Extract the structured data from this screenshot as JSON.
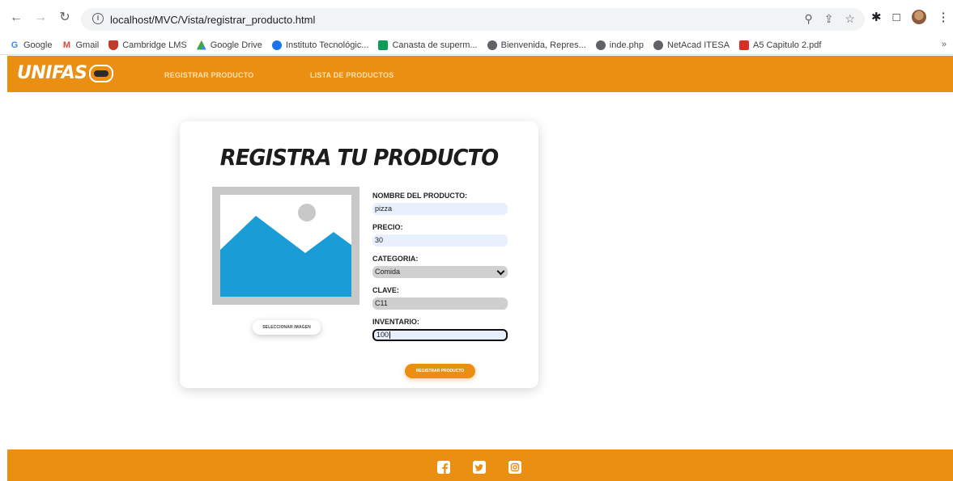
{
  "browser": {
    "url": "localhost/MVC/Vista/registrar_producto.html",
    "bookmarks": [
      {
        "label": "Google",
        "icon": "google-icon",
        "color": "#4285f4"
      },
      {
        "label": "Gmail",
        "icon": "gmail-icon",
        "color": "#ea4335"
      },
      {
        "label": "Cambridge LMS",
        "icon": "cambridge-icon",
        "color": "#c0392b"
      },
      {
        "label": "Google Drive",
        "icon": "drive-icon",
        "color": "#34a853"
      },
      {
        "label": "Instituto Tecnológic...",
        "icon": "institute-icon",
        "color": "#1a73e8"
      },
      {
        "label": "Canasta de superm...",
        "icon": "sheets-icon",
        "color": "#0f9d58"
      },
      {
        "label": "Bienvenida, Repres...",
        "icon": "globe-icon",
        "color": "#5f6368"
      },
      {
        "label": "inde.php",
        "icon": "globe-icon",
        "color": "#5f6368"
      },
      {
        "label": "NetAcad ITESA",
        "icon": "globe-icon",
        "color": "#5f6368"
      },
      {
        "label": "A5 Capitulo 2.pdf",
        "icon": "pdf-icon",
        "color": "#d93025"
      }
    ],
    "more": "»"
  },
  "header": {
    "logo": "UNIFAS",
    "nav": [
      "REGISTRAR PRODUCTO",
      "LISTA DE PRODUCTOS"
    ]
  },
  "card": {
    "title": "REGISTRA TU PRODUCTO",
    "select_image_label": "SELECCIONAR IMAGEN",
    "submit_label": "REGISTRAR PRODUCTO",
    "fields": {
      "nombre": {
        "label": "NOMBRE DEL PRODUCTO:",
        "value": "pizza"
      },
      "precio": {
        "label": "PRECIO:",
        "value": "30"
      },
      "categoria": {
        "label": "CATEGORIA:",
        "value": "Comida"
      },
      "clave": {
        "label": "CLAVE:",
        "value": "C11"
      },
      "inventario": {
        "label": "INVENTARIO:",
        "value": "100"
      }
    }
  },
  "colors": {
    "brand": "#ea8f11",
    "image_blue": "#1a9dd6",
    "field_bg": "#e8f0fe"
  }
}
